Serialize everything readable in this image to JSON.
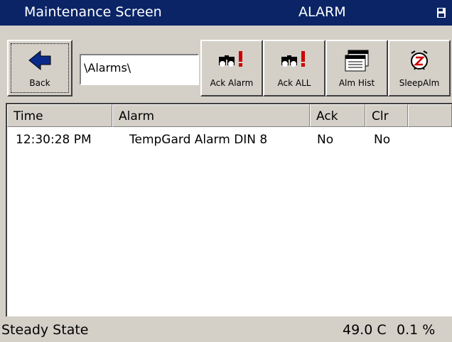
{
  "titlebar": {
    "title": "Maintenance Screen",
    "mode": "ALARM",
    "icon": "save-icon"
  },
  "toolbar": {
    "back_label": "Back",
    "path_value": "\\Alarms\\",
    "ack_alarm_label": "Ack Alarm",
    "ack_all_label": "Ack ALL",
    "alm_hist_label": "Alm Hist",
    "sleep_alm_label": "SleepAlm"
  },
  "table": {
    "columns": [
      "Time",
      "Alarm",
      "Ack",
      "Clr",
      ""
    ],
    "rows": [
      {
        "time": "12:30:28 PM",
        "alarm": "TempGard Alarm DIN 8",
        "ack": "No",
        "clr": "No"
      }
    ]
  },
  "status": {
    "state": "Steady State",
    "temperature": "49.0 C",
    "percent": "0.1 %"
  },
  "colors": {
    "titlebar_bg": "#0a2466",
    "face": "#d4d0c8",
    "alert_red": "#cc0000",
    "back_arrow_blue": "#0a2a8a"
  }
}
